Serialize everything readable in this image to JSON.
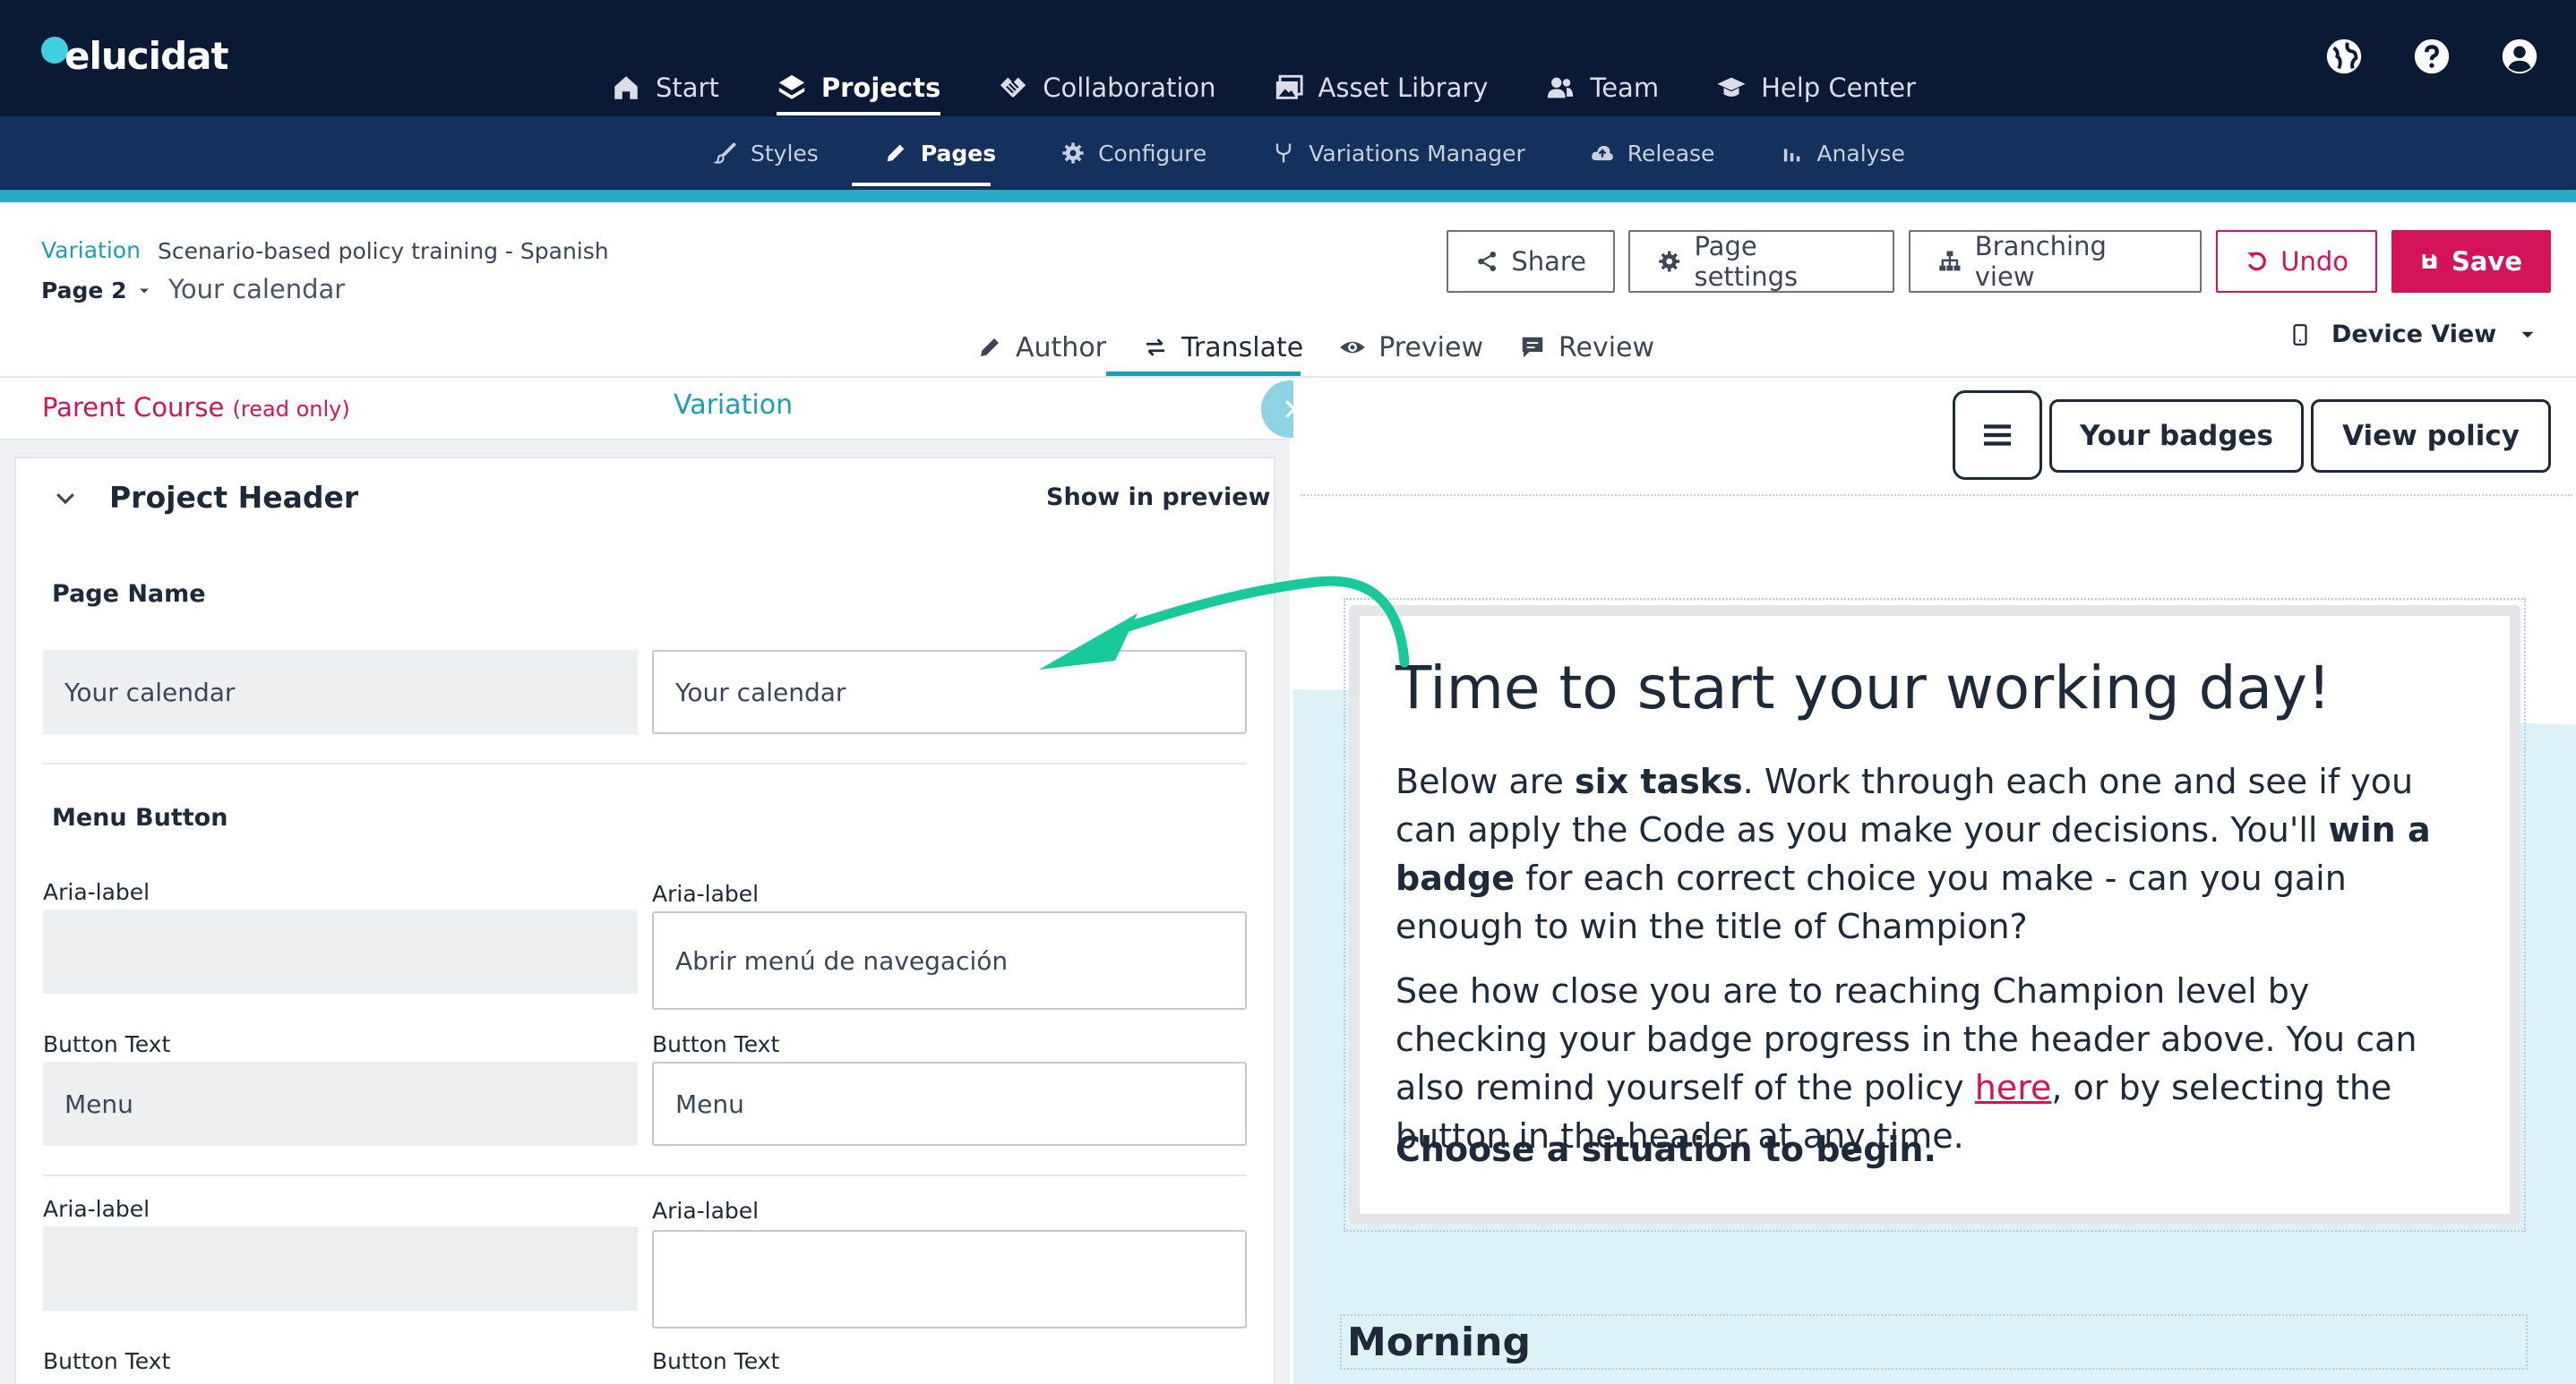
{
  "brand": {
    "logo_text": "elucidat",
    "accent": "#1a9fb5",
    "primary": "#d4145a",
    "nav_bg": "#0a1a35"
  },
  "main_nav": [
    {
      "label": "Start",
      "icon": "home-icon"
    },
    {
      "label": "Projects",
      "icon": "layers-icon",
      "active": true
    },
    {
      "label": "Collaboration",
      "icon": "handshake-icon"
    },
    {
      "label": "Asset Library",
      "icon": "images-icon"
    },
    {
      "label": "Team",
      "icon": "users-icon"
    },
    {
      "label": "Help Center",
      "icon": "graduation-cap-icon"
    }
  ],
  "utility_icons": [
    "globe-icon",
    "help-icon",
    "user-circle-icon"
  ],
  "sub_nav": [
    {
      "label": "Styles",
      "icon": "brush-icon"
    },
    {
      "label": "Pages",
      "icon": "pencil-icon",
      "active": true
    },
    {
      "label": "Configure",
      "icon": "gear-icon"
    },
    {
      "label": "Variations Manager",
      "icon": "fork-icon"
    },
    {
      "label": "Release",
      "icon": "cloud-upload-icon"
    },
    {
      "label": "Analyse",
      "icon": "bar-chart-icon"
    }
  ],
  "header": {
    "variation_label": "Variation",
    "variation_name": "Scenario-based policy training - Spanish",
    "page_select": "Page 2",
    "page_name": "Your calendar"
  },
  "toolbar": {
    "share": "Share",
    "page_settings": "Page settings",
    "branching_view": "Branching view",
    "undo": "Undo",
    "save": "Save"
  },
  "mode_tabs": [
    {
      "label": "Author",
      "icon": "pencil-icon"
    },
    {
      "label": "Translate",
      "icon": "swap-icon",
      "active": true
    },
    {
      "label": "Preview",
      "icon": "eye-icon"
    },
    {
      "label": "Review",
      "icon": "comment-icon"
    }
  ],
  "device_view": "Device View",
  "left_panel": {
    "parent_course": "Parent Course",
    "read_only": "(read only)",
    "variation": "Variation",
    "section_title": "Project Header",
    "show_in_preview": "Show in preview",
    "page_name_label": "Page Name",
    "page_name_parent": "Your calendar",
    "page_name_variation": "Your calendar",
    "menu_button_label": "Menu Button",
    "aria_label": "Aria-label",
    "aria_parent": "",
    "aria_variation": "Abrir menú de navegación",
    "button_text_label": "Button Text",
    "button_text_parent": "Menu",
    "button_text_variation": "Menu",
    "aria2_parent": "",
    "aria2_variation": ""
  },
  "preview": {
    "your_badges": "Your badges",
    "view_policy": "View policy",
    "title": "Time to start your working day!",
    "p1_a": "Below are ",
    "p1_b": "six tasks",
    "p1_c": ". Work through each one and see if you can apply the Code as you make your decisions. You'll ",
    "p1_d": "win a badge",
    "p1_e": " for each correct choice you make - can you gain enough to win the title of Champion?",
    "p2_a": "See how close you are to reaching Champion level by checking your badge progress in the header above. You can also remind yourself of the policy ",
    "p2_link": "here",
    "p2_b": ", or by selecting the button in the header at any time.",
    "cta": "Choose a situation to begin.",
    "morning": "Morning"
  }
}
